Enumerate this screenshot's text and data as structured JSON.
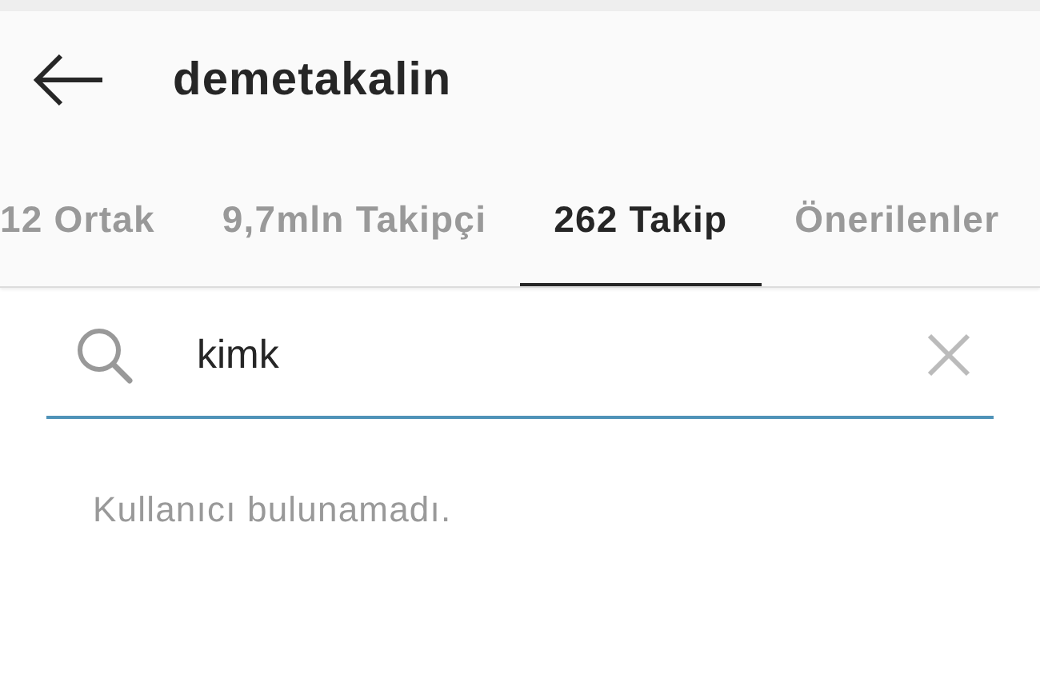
{
  "header": {
    "title": "demetakalin"
  },
  "tabs": [
    {
      "label": "12 Ortak",
      "selected": false
    },
    {
      "label": "9,7mln Takipçi",
      "selected": false
    },
    {
      "label": "262 Takip",
      "selected": true
    },
    {
      "label": "Önerilenler",
      "selected": false
    }
  ],
  "search": {
    "value": "kimk"
  },
  "message": "Kullanıcı bulunamadı."
}
